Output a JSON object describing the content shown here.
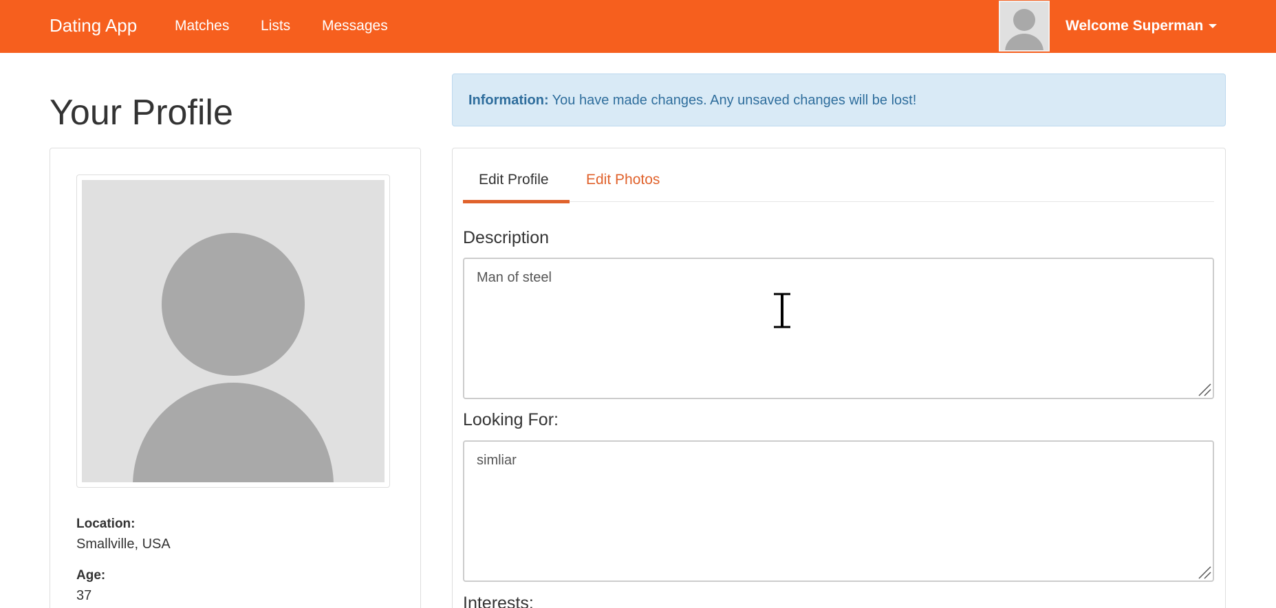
{
  "navbar": {
    "brand": "Dating App",
    "links": [
      "Matches",
      "Lists",
      "Messages"
    ],
    "welcome": "Welcome Superman",
    "color": "#f65f1e"
  },
  "page_title": "Your Profile",
  "alert": {
    "label": "Information:",
    "message": "You have made changes. Any unsaved changes will be lost!"
  },
  "profile": {
    "location_label": "Location:",
    "location_value": "Smallville, USA",
    "age_label": "Age:",
    "age_value": "37"
  },
  "tabs": [
    {
      "label": "Edit Profile",
      "active": true
    },
    {
      "label": "Edit Photos",
      "active": false
    }
  ],
  "form": {
    "description_label": "Description",
    "description_value": "Man of steel",
    "looking_for_label": "Looking For:",
    "looking_for_value": "simliar",
    "interests_label": "Interests:"
  },
  "icons": {
    "avatar": "user-placeholder-icon",
    "caret": "caret-down-icon",
    "cursor": "text-cursor-icon"
  },
  "colors": {
    "accent": "#e0622c",
    "alert_bg": "#d9eaf6",
    "alert_text": "#2e6d9c"
  }
}
